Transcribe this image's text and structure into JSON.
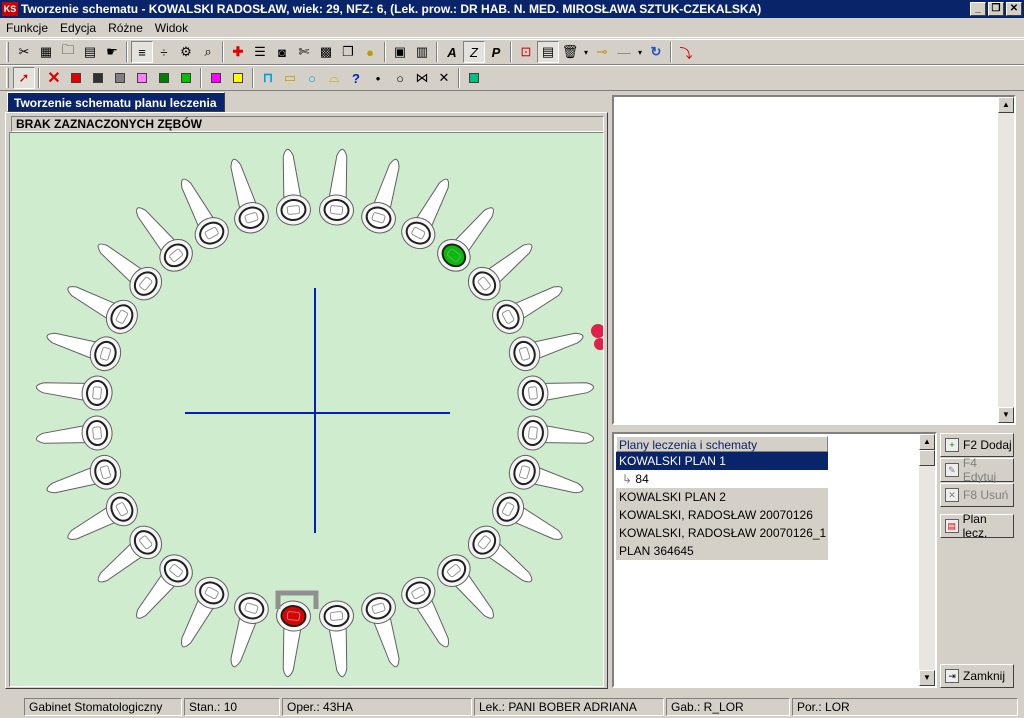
{
  "window": {
    "title": "Tworzenie schematu - KOWALSKI RADOSŁAW, wiek: 29, NFZ: 6, (Lek. prow.: DR HAB. N. MED. MIROSŁAWA SZTUK-CZEKALSKA)",
    "app_icon_label": "KS",
    "buttons": [
      "_",
      "❐",
      "✕"
    ]
  },
  "menu": [
    "Funkcje",
    "Edycja",
    "Różne",
    "Widok"
  ],
  "toolbar1": {
    "icons": [
      "tools-icon",
      "calendar-icon",
      "folder-icon",
      "document-icon",
      "hand-icon",
      "ruler-icon",
      "fraction-icon",
      "gear-icon",
      "magnifier-icon",
      "red-cross-icon",
      "list-icon",
      "camera-icon",
      "scissors-icon",
      "grid-icon",
      "copy-icon",
      "coin-icon",
      "image-icon",
      "calc-icon",
      "font-a-icon",
      "font-z-icon",
      "font-p-icon",
      "insert-icon",
      "table-icon",
      "trash-icon",
      "key-icon",
      "line-icon",
      "refresh-icon",
      "clip-icon"
    ],
    "font_buttons": [
      "A",
      "Z",
      "P"
    ]
  },
  "toolbar2": {
    "colors": [
      "#e00000",
      "#303030",
      "#808080",
      "#ff80ff",
      "#008000",
      "#00c000",
      "#ff00ff",
      "#ffff00"
    ],
    "shape_icons": [
      "bracket-icon",
      "rect-icon",
      "circle-icon",
      "crown-icon",
      "question-icon",
      "dot-icon",
      "ring-icon",
      "cross-icon",
      "x-icon",
      "green-square-icon"
    ],
    "question_label": "?"
  },
  "left_panel": {
    "tab_label": "Tworzenie schematu planu leczenia",
    "status_text": "BRAK ZAZNACZONYCH ZĘBÓW"
  },
  "plans": {
    "header": "Plany leczenia i schematy",
    "items": [
      {
        "label": "KOWALSKI PLAN 1",
        "selected": true
      },
      {
        "label": "84",
        "child": true
      },
      {
        "label": "KOWALSKI PLAN 2"
      },
      {
        "label": "KOWALSKI, RADOSŁAW 20070126"
      },
      {
        "label": "KOWALSKI, RADOSŁAW 20070126_1"
      },
      {
        "label": "PLAN 364645"
      }
    ]
  },
  "side_buttons": {
    "add": "F2 Dodaj",
    "edit": "F4 Edytuj",
    "delete": "F8 Usuń",
    "plan": "Plan lecz.",
    "close": "Zamknij"
  },
  "statusbar": {
    "clinic": "Gabinet Stomatologiczny",
    "stan": "Stan.: 10",
    "oper": "Oper.: 43HA",
    "lek": "Lek.: PANI  BOBER ADRIANA",
    "gab": "Gab.: R_LOR",
    "por": "Por.: LOR"
  },
  "colors": {
    "canvas_bg": "#cfeccf",
    "crosshair": "#0020c0",
    "highlight_green": "#00c000",
    "highlight_red": "#e00000",
    "marker_pink": "#e0204a"
  }
}
